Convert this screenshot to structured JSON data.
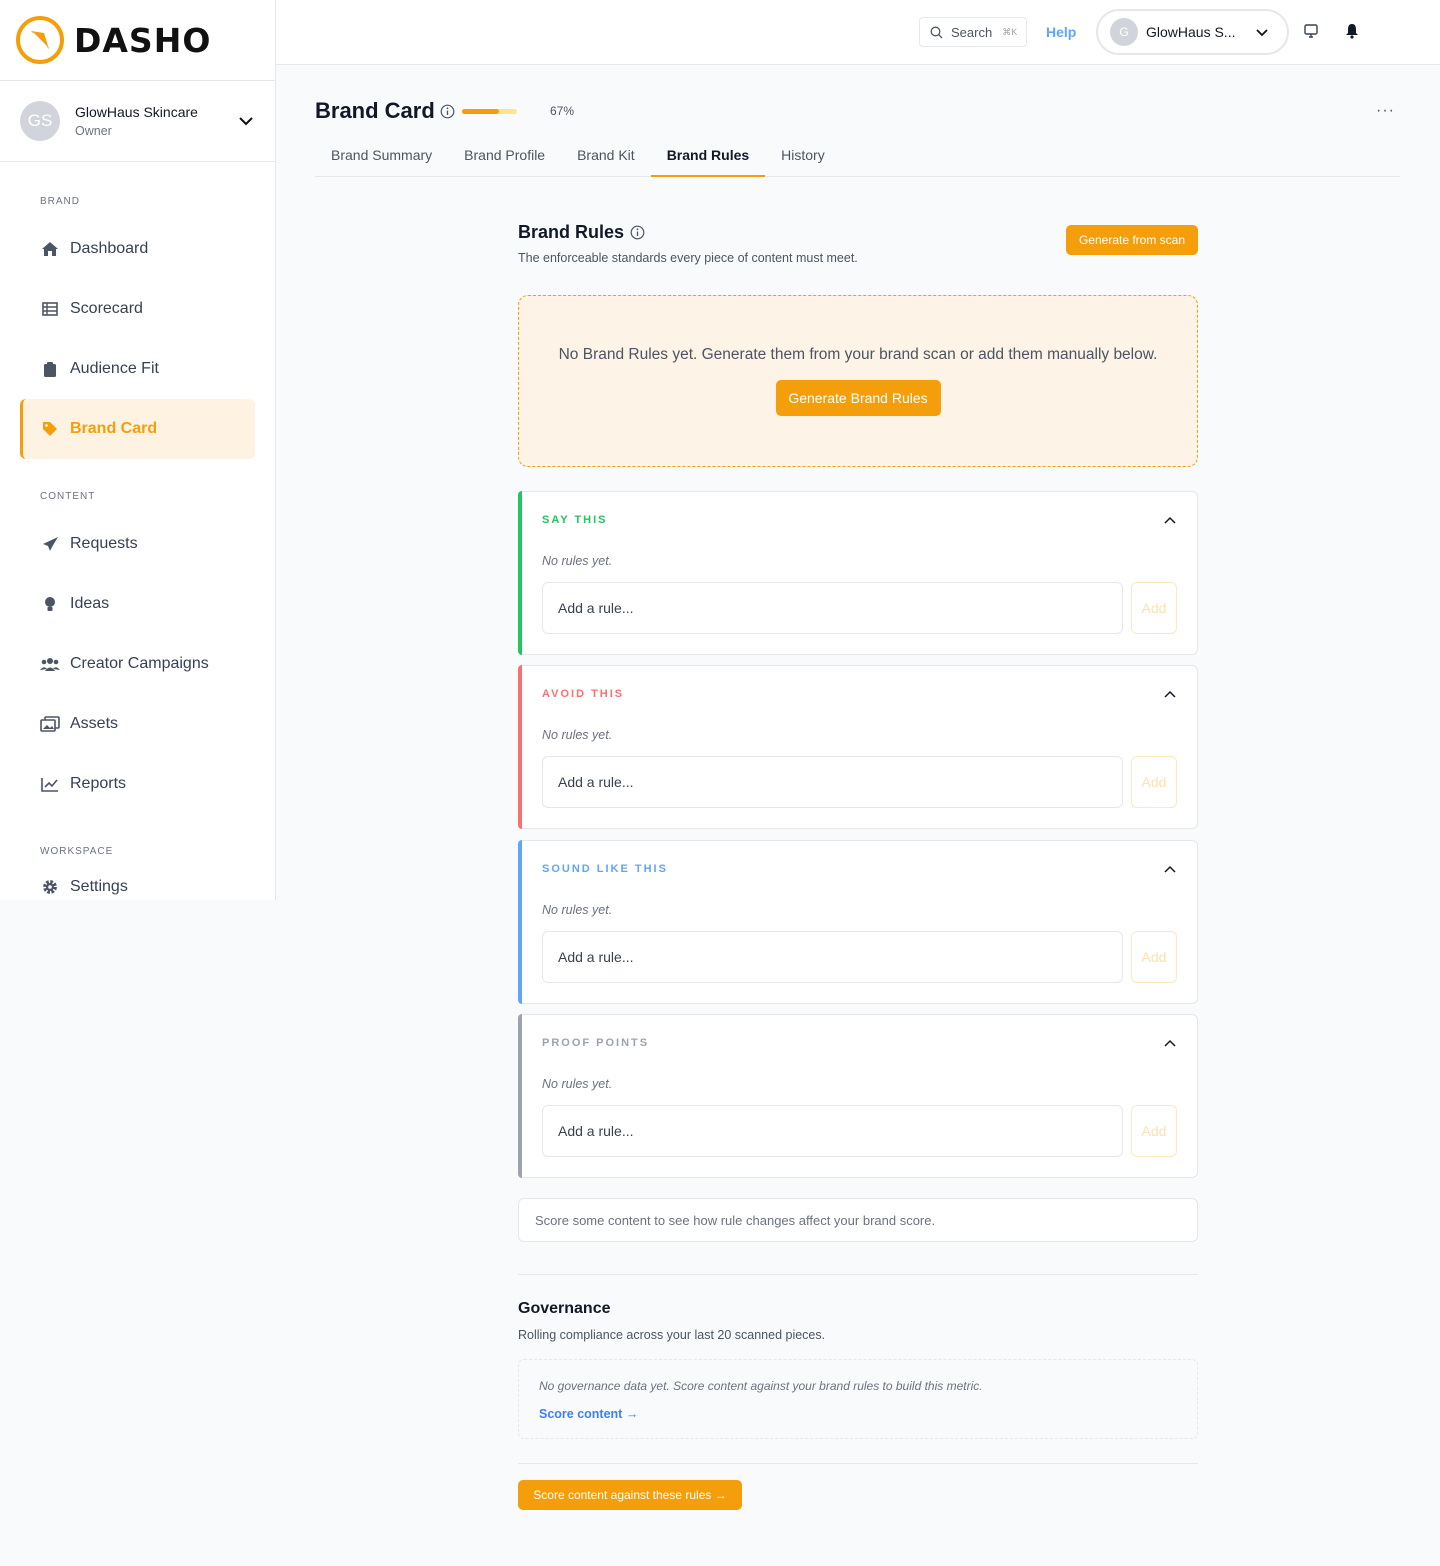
{
  "brand": {
    "logo_text": "DASHO",
    "accent": "#f59e0b"
  },
  "account": {
    "initials": "GS",
    "name": "GlowHaus Skincare",
    "role": "Owner"
  },
  "sidebar": {
    "sections": [
      {
        "label": "BRAND",
        "items": [
          {
            "label": "Dashboard",
            "icon": "home-icon"
          },
          {
            "label": "Scorecard",
            "icon": "table-icon"
          },
          {
            "label": "Audience Fit",
            "icon": "clipboard-icon"
          },
          {
            "label": "Brand Card",
            "icon": "tag-icon",
            "active": true
          }
        ]
      },
      {
        "label": "CONTENT",
        "items": [
          {
            "label": "Requests",
            "icon": "paper-plane-icon"
          },
          {
            "label": "Ideas",
            "icon": "lightbulb-icon"
          },
          {
            "label": "Creator Campaigns",
            "icon": "users-icon"
          },
          {
            "label": "Assets",
            "icon": "images-icon"
          },
          {
            "label": "Reports",
            "icon": "line-chart-icon"
          }
        ]
      },
      {
        "label": "WORKSPACE",
        "items": [
          {
            "label": "Settings",
            "icon": "gear-icon"
          }
        ]
      }
    ]
  },
  "topbar": {
    "search_label": "Search",
    "search_shortcut": "⌘K",
    "help_label": "Help",
    "user_initial": "G",
    "user_name": "GlowHaus S..."
  },
  "page": {
    "title": "Brand Card",
    "progress_percent": 67,
    "progress_text": "67%",
    "more_label": "···",
    "tabs": [
      {
        "label": "Brand Summary"
      },
      {
        "label": "Brand Profile"
      },
      {
        "label": "Brand Kit"
      },
      {
        "label": "Brand Rules",
        "active": true
      },
      {
        "label": "History"
      }
    ]
  },
  "rules": {
    "title": "Brand Rules",
    "subtitle": "The enforceable standards every piece of content must meet.",
    "generate_from_scan": "Generate from scan",
    "empty_text": "No Brand Rules yet. Generate them from your brand scan or add them manually below.",
    "generate_button": "Generate Brand Rules",
    "groups": [
      {
        "title": "SAY THIS",
        "color": "#22c55e",
        "empty": "No rules yet.",
        "placeholder": "Add a rule...",
        "add": "Add"
      },
      {
        "title": "AVOID THIS",
        "color": "#f87171",
        "empty": "No rules yet.",
        "placeholder": "Add a rule...",
        "add": "Add"
      },
      {
        "title": "SOUND LIKE THIS",
        "color": "#60a5fa",
        "empty": "No rules yet.",
        "placeholder": "Add a rule...",
        "add": "Add"
      },
      {
        "title": "PROOF POINTS",
        "color": "#9ca3af",
        "empty": "No rules yet.",
        "placeholder": "Add a rule...",
        "add": "Add"
      }
    ],
    "score_note": "Score some content to see how rule changes affect your brand score."
  },
  "governance": {
    "title": "Governance",
    "subtitle": "Rolling compliance across your last 20 scanned pieces.",
    "empty": "No governance data yet. Score content against your brand rules to build this metric.",
    "link": "Score content →"
  },
  "footer_button": "Score content against these rules →"
}
